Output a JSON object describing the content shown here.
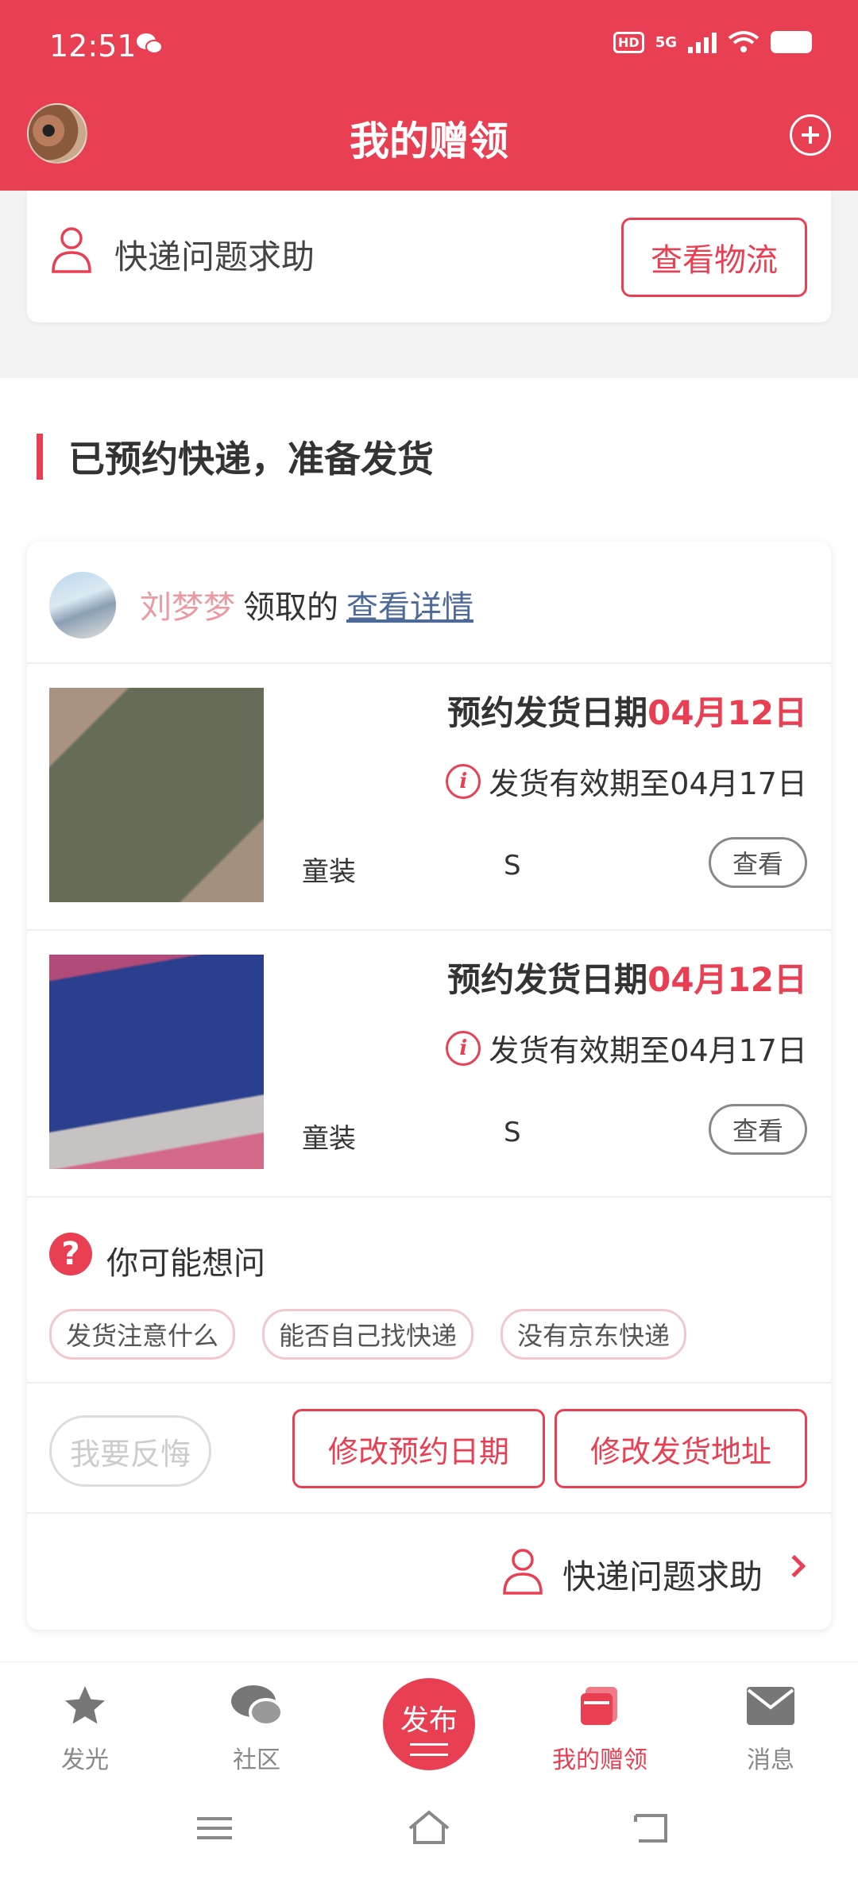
{
  "status_bar": {
    "time": "12:51",
    "hd": "HD",
    "network": "5G"
  },
  "header": {
    "title": "我的赠领"
  },
  "top_card": {
    "help_text": "快递问题求助",
    "logistics_button": "查看物流"
  },
  "section": {
    "title": "已预约快递，准备发货"
  },
  "order": {
    "claimer_name": "刘梦梦",
    "claim_suffix": "领取的",
    "detail_link": "查看详情",
    "items": [
      {
        "ship_label": "预约发货日期",
        "ship_date": "04月12日",
        "valid_text": "发货有效期至04月17日",
        "category": "童装",
        "size": "S",
        "view_button": "查看"
      },
      {
        "ship_label": "预约发货日期",
        "ship_date": "04月12日",
        "valid_text": "发货有效期至04月17日",
        "category": "童装",
        "size": "S",
        "view_button": "查看"
      }
    ],
    "faq": {
      "title": "你可能想问",
      "tags": [
        "发货注意什么",
        "能否自己找快递",
        "没有京东快递"
      ]
    },
    "actions": {
      "regret": "我要反悔",
      "change_date": "修改预约日期",
      "change_address": "修改发货地址"
    },
    "help_text": "快递问题求助"
  },
  "tabbar": {
    "items": [
      {
        "label": "发光",
        "icon": "star-icon"
      },
      {
        "label": "社区",
        "icon": "chat-bubble-icon"
      },
      {
        "label": "发布",
        "icon": "publish-icon"
      },
      {
        "label": "我的赠领",
        "icon": "gift-box-icon",
        "active": true
      },
      {
        "label": "消息",
        "icon": "mail-icon"
      }
    ]
  },
  "colors": {
    "accent": "#e83f52",
    "link": "#4d6a99",
    "claimer_name": "#e99aa3"
  }
}
